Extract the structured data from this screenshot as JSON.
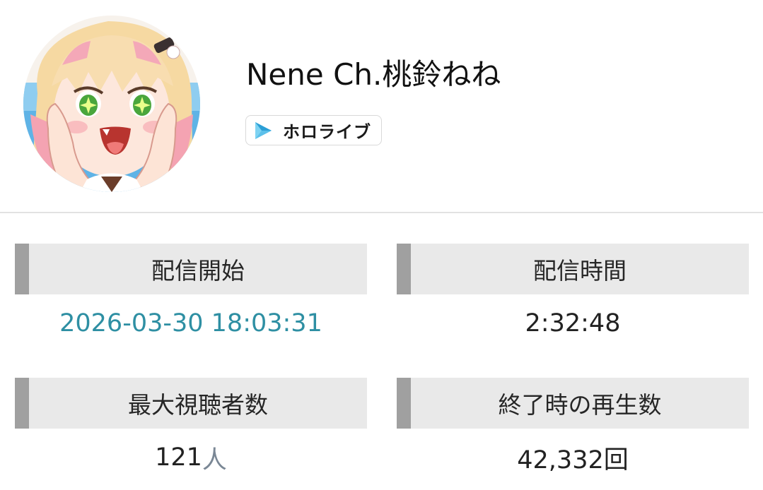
{
  "channel": {
    "name": "Nene Ch.桃鈴ねね",
    "organization": "ホロライブ",
    "avatar_icon": "channel-avatar-image",
    "organization_icon": "hololive-triangle-icon",
    "colors": {
      "org_icon_light": "#7ed3f2",
      "org_icon_dark": "#2b9fd6"
    }
  },
  "stats": {
    "start": {
      "label": "配信開始",
      "value": "2026-03-30 18:03:31"
    },
    "duration": {
      "label": "配信時間",
      "value": "2:32:48"
    },
    "max_viewers": {
      "label": "最大視聴者数",
      "value": "121",
      "unit": "人"
    },
    "final_views": {
      "label": "終了時の再生数",
      "value": "42,332回"
    },
    "colors": {
      "header_bg": "#e9e9e9",
      "header_accent": "#a0a0a0",
      "link": "#2e8fa3"
    }
  }
}
